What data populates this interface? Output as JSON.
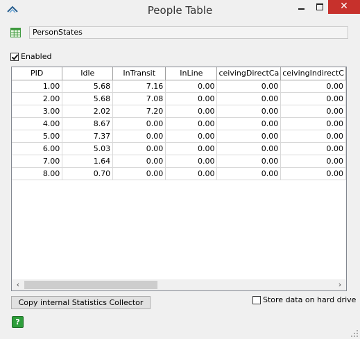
{
  "window": {
    "title": "People Table",
    "close_glyph": "✕"
  },
  "name_field": {
    "value": "PersonStates"
  },
  "enabled": {
    "label": "Enabled",
    "checked": true
  },
  "table": {
    "columns": [
      "PID",
      "Idle",
      "InTransit",
      "InLine",
      "ceivingDirectCa",
      "ceivingIndirectC"
    ],
    "rows": [
      [
        "1.00",
        "5.68",
        "7.16",
        "0.00",
        "0.00",
        "0.00"
      ],
      [
        "2.00",
        "5.68",
        "7.08",
        "0.00",
        "0.00",
        "0.00"
      ],
      [
        "3.00",
        "2.02",
        "7.20",
        "0.00",
        "0.00",
        "0.00"
      ],
      [
        "4.00",
        "8.67",
        "0.00",
        "0.00",
        "0.00",
        "0.00"
      ],
      [
        "5.00",
        "7.37",
        "0.00",
        "0.00",
        "0.00",
        "0.00"
      ],
      [
        "6.00",
        "5.03",
        "0.00",
        "0.00",
        "0.00",
        "0.00"
      ],
      [
        "7.00",
        "1.64",
        "0.00",
        "0.00",
        "0.00",
        "0.00"
      ],
      [
        "8.00",
        "0.70",
        "0.00",
        "0.00",
        "0.00",
        "0.00"
      ]
    ]
  },
  "scrollbar": {
    "left_glyph": "‹",
    "right_glyph": "›"
  },
  "copy_button": {
    "label": "Copy internal Statistics Collector"
  },
  "store_data": {
    "label": "Store data on hard drive",
    "checked": false
  },
  "help": {
    "glyph": "?"
  },
  "icons": [
    "app-logo-icon",
    "table-grid-icon",
    "help-icon",
    "resize-grip-icon"
  ]
}
